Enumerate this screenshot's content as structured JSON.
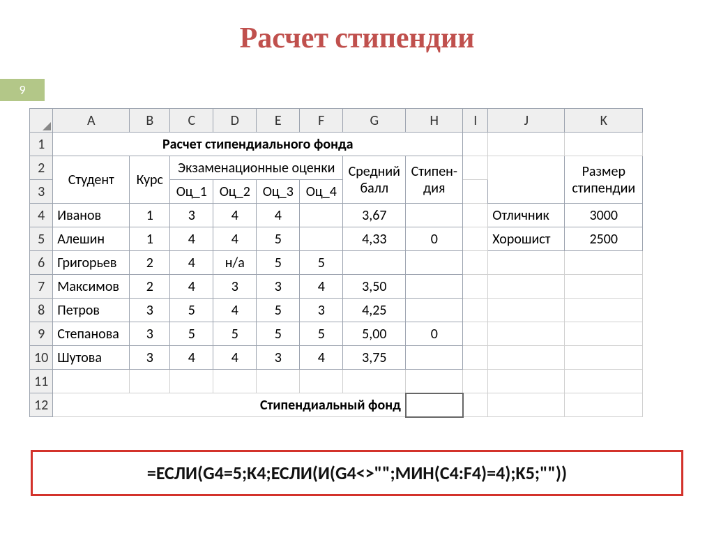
{
  "slide": {
    "number": "9",
    "title": "Расчет стипендии"
  },
  "columns": [
    "A",
    "B",
    "C",
    "D",
    "E",
    "F",
    "G",
    "H",
    "I",
    "J",
    "K"
  ],
  "rows": [
    "1",
    "2",
    "3",
    "4",
    "5",
    "6",
    "7",
    "8",
    "9",
    "10",
    "11",
    "12"
  ],
  "merged_title": "Расчет стипендиального фонда",
  "headers": {
    "student": "Студент",
    "course": "Курс",
    "exam_scores": "Экзаменационные оценки",
    "avg": "Средний балл",
    "stipend": "Стипен-дия",
    "oc1": "Оц_1",
    "oc2": "Оц_2",
    "oc3": "Оц_3",
    "oc4": "Оц_4",
    "size_label": "Размер стипендии"
  },
  "students": [
    {
      "name": "Иванов",
      "course": "1",
      "s1": "3",
      "s2": "4",
      "s3": "4",
      "s4": "",
      "avg": "3,67",
      "stip": ""
    },
    {
      "name": "Алешин",
      "course": "1",
      "s1": "4",
      "s2": "4",
      "s3": "5",
      "s4": "",
      "avg": "4,33",
      "stip": "0"
    },
    {
      "name": "Григорьев",
      "course": "2",
      "s1": "4",
      "s2": "н/а",
      "s3": "5",
      "s4": "5",
      "avg": "",
      "stip": ""
    },
    {
      "name": "Максимов",
      "course": "2",
      "s1": "4",
      "s2": "3",
      "s3": "3",
      "s4": "4",
      "avg": "3,50",
      "stip": ""
    },
    {
      "name": "Петров",
      "course": "3",
      "s1": "5",
      "s2": "4",
      "s3": "5",
      "s4": "3",
      "avg": "4,25",
      "stip": ""
    },
    {
      "name": "Степанова",
      "course": "3",
      "s1": "5",
      "s2": "5",
      "s3": "5",
      "s4": "5",
      "avg": "5,00",
      "stip": "0"
    },
    {
      "name": "Шутова",
      "course": "3",
      "s1": "4",
      "s2": "4",
      "s3": "3",
      "s4": "4",
      "avg": "3,75",
      "stip": ""
    }
  ],
  "fund_label": "Стипендиальный фонд",
  "lookup": [
    {
      "label": "Отличник",
      "value": "3000"
    },
    {
      "label": "Хорошист",
      "value": "2500"
    }
  ],
  "formula": "=ЕСЛИ(G4=5;K4;ЕСЛИ(И(G4<>\"\";МИН(C4:F4)=4);K5;\"\"))",
  "chart_data": {
    "type": "table",
    "title": "Расчет стипендиального фонда",
    "columns": [
      "Студент",
      "Курс",
      "Оц_1",
      "Оц_2",
      "Оц_3",
      "Оц_4",
      "Средний балл",
      "Стипендия"
    ],
    "rows": [
      [
        "Иванов",
        1,
        3,
        4,
        4,
        null,
        3.67,
        null
      ],
      [
        "Алешин",
        1,
        4,
        4,
        5,
        null,
        4.33,
        0
      ],
      [
        "Григорьев",
        2,
        4,
        "н/а",
        5,
        5,
        null,
        null
      ],
      [
        "Максимов",
        2,
        4,
        3,
        3,
        4,
        3.5,
        null
      ],
      [
        "Петров",
        3,
        5,
        4,
        5,
        3,
        4.25,
        null
      ],
      [
        "Степанова",
        3,
        5,
        5,
        5,
        5,
        5.0,
        0
      ],
      [
        "Шутова",
        3,
        4,
        4,
        3,
        4,
        3.75,
        null
      ]
    ],
    "lookup_table": {
      "Отличник": 3000,
      "Хорошист": 2500
    }
  }
}
